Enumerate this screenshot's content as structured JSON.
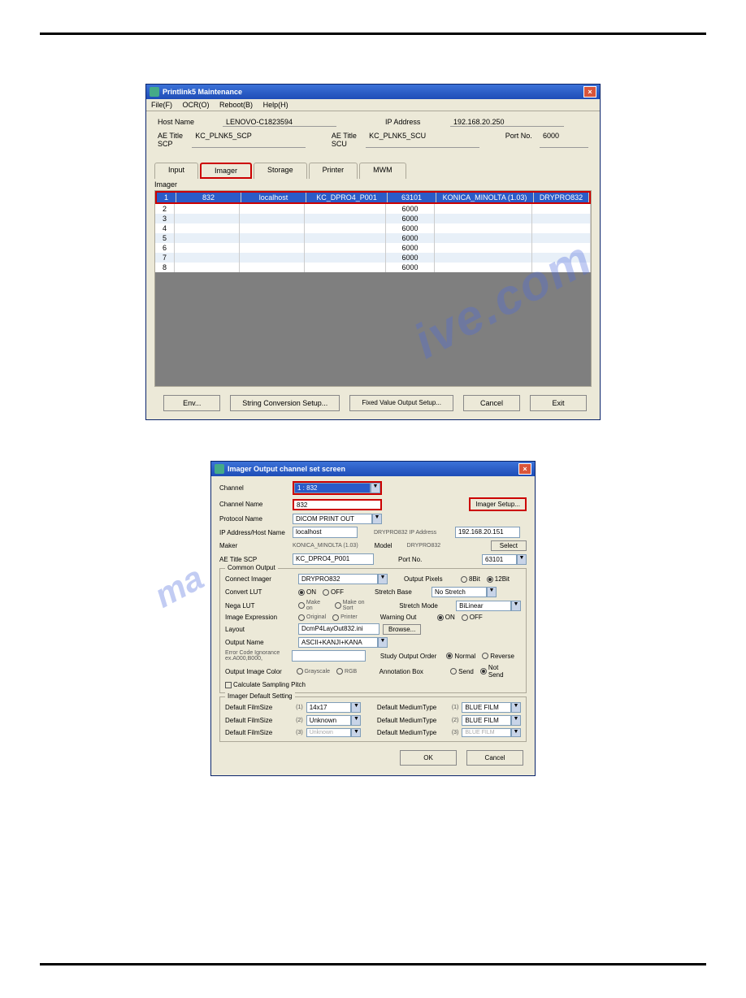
{
  "wm1": "ive.com",
  "wm2": "ma",
  "w1": {
    "title": "Printlink5 Maintenance",
    "menu": [
      "File(F)",
      "OCR(O)",
      "Reboot(B)",
      "Help(H)"
    ],
    "lbl": {
      "host": "Host Name",
      "ip": "IP Address",
      "scp": "AE Title SCP",
      "scu": "AE Title SCU",
      "port": "Port No."
    },
    "val": {
      "host": "LENOVO-C1823594",
      "ip": "192.168.20.250",
      "scp": "KC_PLNK5_SCP",
      "scu": "KC_PLNK5_SCU",
      "port": "6000"
    },
    "tabs": [
      "Input",
      "Imager",
      "Storage",
      "Printer",
      "MWM"
    ],
    "section": "Imager",
    "rows": [
      {
        "n": "1",
        "a": "832",
        "b": "localhost",
        "c": "KC_DPRO4_P001",
        "d": "63101",
        "e": "KONICA_MINOLTA (1.03)",
        "f": "DRYPRO832"
      },
      {
        "n": "2",
        "d": "6000"
      },
      {
        "n": "3",
        "d": "6000"
      },
      {
        "n": "4",
        "d": "6000"
      },
      {
        "n": "5",
        "d": "6000"
      },
      {
        "n": "6",
        "d": "6000"
      },
      {
        "n": "7",
        "d": "6000"
      },
      {
        "n": "8",
        "d": "6000"
      }
    ],
    "btns": [
      "Env...",
      "String Conversion Setup...",
      "Fixed Value Output Setup...",
      "Cancel",
      "Exit"
    ]
  },
  "w2": {
    "title": "Imager Output channel set screen",
    "imgbtn": "Imager Setup...",
    "selbtn": "Select",
    "browse": "Browse...",
    "ok": "OK",
    "cancel": "Cancel",
    "g1": "Common Output",
    "g2": "Imager Default Setting",
    "l": {
      "ch": "Channel",
      "cn": "Channel Name",
      "pn": "Protocol Name",
      "ih": "IP Address/Host Name",
      "dip": "DRYPRO832 IP Address",
      "mk": "Maker",
      "md": "Model",
      "ae": "AE Title SCP",
      "pt": "Port No.",
      "ci": "Connect Imager",
      "op": "Output Pixels",
      "cl": "Convert LUT",
      "sb": "Stretch Base",
      "nl": "Nega LUT",
      "sm": "Stretch Mode",
      "ie": "Image Expression",
      "wo": "Warning Out",
      "ly": "Layout",
      "on": "Output Name",
      "ec": "Error Code Ignorance ex.A000,B000,",
      "so": "Study Output Order",
      "oc": "Output Image Color",
      "ab": "Annotation Box",
      "cs": "Calculate Sampling Pitch",
      "fs": "Default FilmSize",
      "mt": "Default MediumType"
    },
    "v": {
      "ch": "1 : 832",
      "cn": "832",
      "pn": "DICOM PRINT OUT",
      "ih": "localhost",
      "dip": "192.168.20.151",
      "mk": "KONICA_MINOLTA (1.03)",
      "md": "DRYPRO832",
      "ae": "KC_DPRO4_P001",
      "pt": "63101",
      "ci": "DRYPRO832",
      "sb": "No Stretch",
      "sm": "BiLinear",
      "ly": "DcmP4LayOut832.ini",
      "on": "ASCII+KANJI+KANA",
      "fs1": "14x17",
      "fs2": "Unknown",
      "fs3": "Unknown",
      "mt1": "BLUE FILM",
      "mt2": "BLUE FILM",
      "mt3": "BLUE FILM"
    },
    "r": {
      "b8": "8Bit",
      "b12": "12Bit",
      "on": "ON",
      "off": "OFF",
      "n1": "Make on",
      "n2": "Make on Sort",
      "ie1": "Original",
      "ie2": "Printer",
      "nm": "Normal",
      "rv": "Reverse",
      "oc1": "Grayscale",
      "oc2": "RGB",
      "sd": "Send",
      "ns": "Not Send"
    }
  }
}
